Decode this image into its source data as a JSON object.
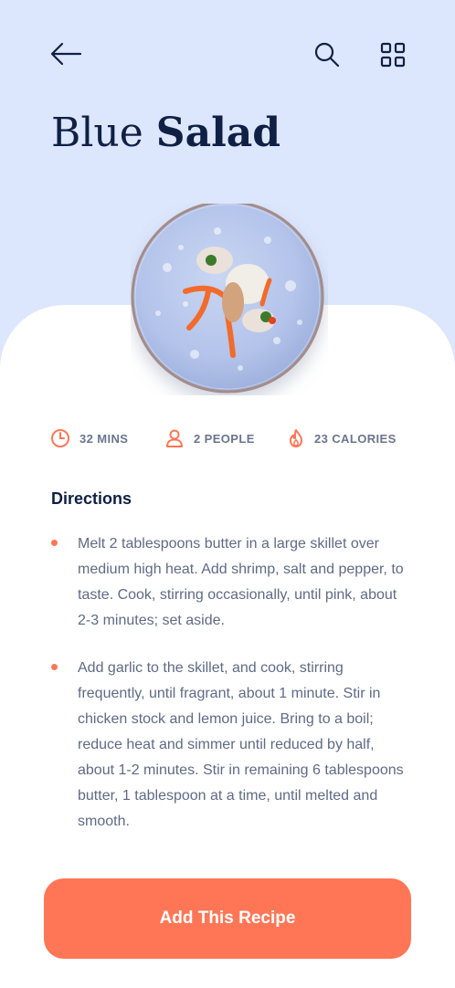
{
  "colors": {
    "header_background": "#dce6fd",
    "accent": "#ff7656",
    "title_text": "#0f2044",
    "body_text": "#5f6a86",
    "meta_text": "#6b7490"
  },
  "header": {
    "back_icon": "arrow-left-icon",
    "search_icon": "search-icon",
    "menu_icon": "grid-icon",
    "title_light": "Blue",
    "title_bold": "Salad"
  },
  "hero_image": {
    "subject": "plated salad on a blue speckled ceramic plate"
  },
  "meta": {
    "time": {
      "icon": "clock-icon",
      "label": "32 MINS"
    },
    "people": {
      "icon": "person-icon",
      "label": "2 PEOPLE"
    },
    "calories": {
      "icon": "flame-icon",
      "label": "23 CALORIES"
    }
  },
  "directions": {
    "title": "Directions",
    "steps": [
      "Melt 2 tablespoons butter in a large skillet over medium high heat. Add shrimp, salt and pepper, to taste. Cook, stirring occasionally, until pink, about 2-3 minutes; set aside.",
      "Add garlic to the skillet, and cook, stirring frequently, until fragrant, about 1 minute. Stir in chicken stock and lemon juice. Bring to a boil; reduce heat and simmer until reduced by half, about 1-2 minutes. Stir in remaining 6 tablespoons butter, 1 tablespoon at a time, until melted and smooth."
    ]
  },
  "cta": {
    "label": "Add This Recipe"
  }
}
